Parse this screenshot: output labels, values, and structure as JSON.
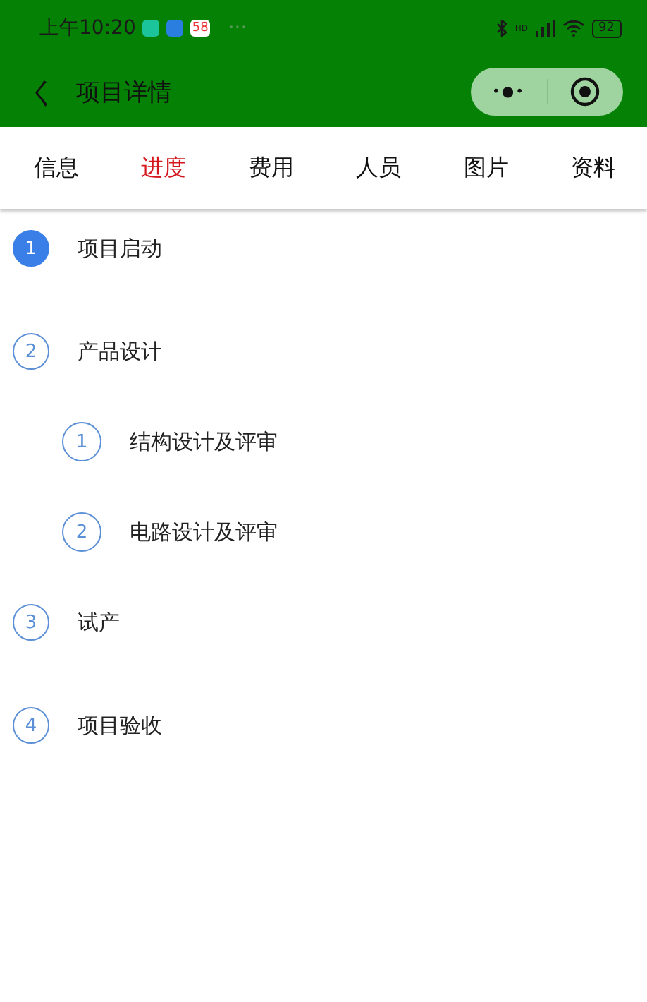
{
  "status_bar": {
    "time": "上午10:20",
    "app_badge": "58",
    "more": "···",
    "hd": "HD",
    "battery": "92"
  },
  "title_bar": {
    "back": "く",
    "title": "项目详情",
    "menu": "•●•"
  },
  "tabs": [
    {
      "label": "信息",
      "selected": false
    },
    {
      "label": "进度",
      "selected": true
    },
    {
      "label": "费用",
      "selected": false
    },
    {
      "label": "人员",
      "selected": false
    },
    {
      "label": "图片",
      "selected": false
    },
    {
      "label": "资料",
      "selected": false
    }
  ],
  "steps": [
    {
      "number": "1",
      "title": "项目启动",
      "selected": true
    },
    {
      "number": "2",
      "title": "产品设计",
      "selected": false,
      "children": [
        {
          "number": "1",
          "title": "结构设计及评审",
          "selected": false
        },
        {
          "number": "2",
          "title": "电路设计及评审",
          "selected": false
        }
      ]
    },
    {
      "number": "3",
      "title": "试产",
      "selected": false
    },
    {
      "number": "4",
      "title": "项目验收",
      "selected": false
    }
  ]
}
